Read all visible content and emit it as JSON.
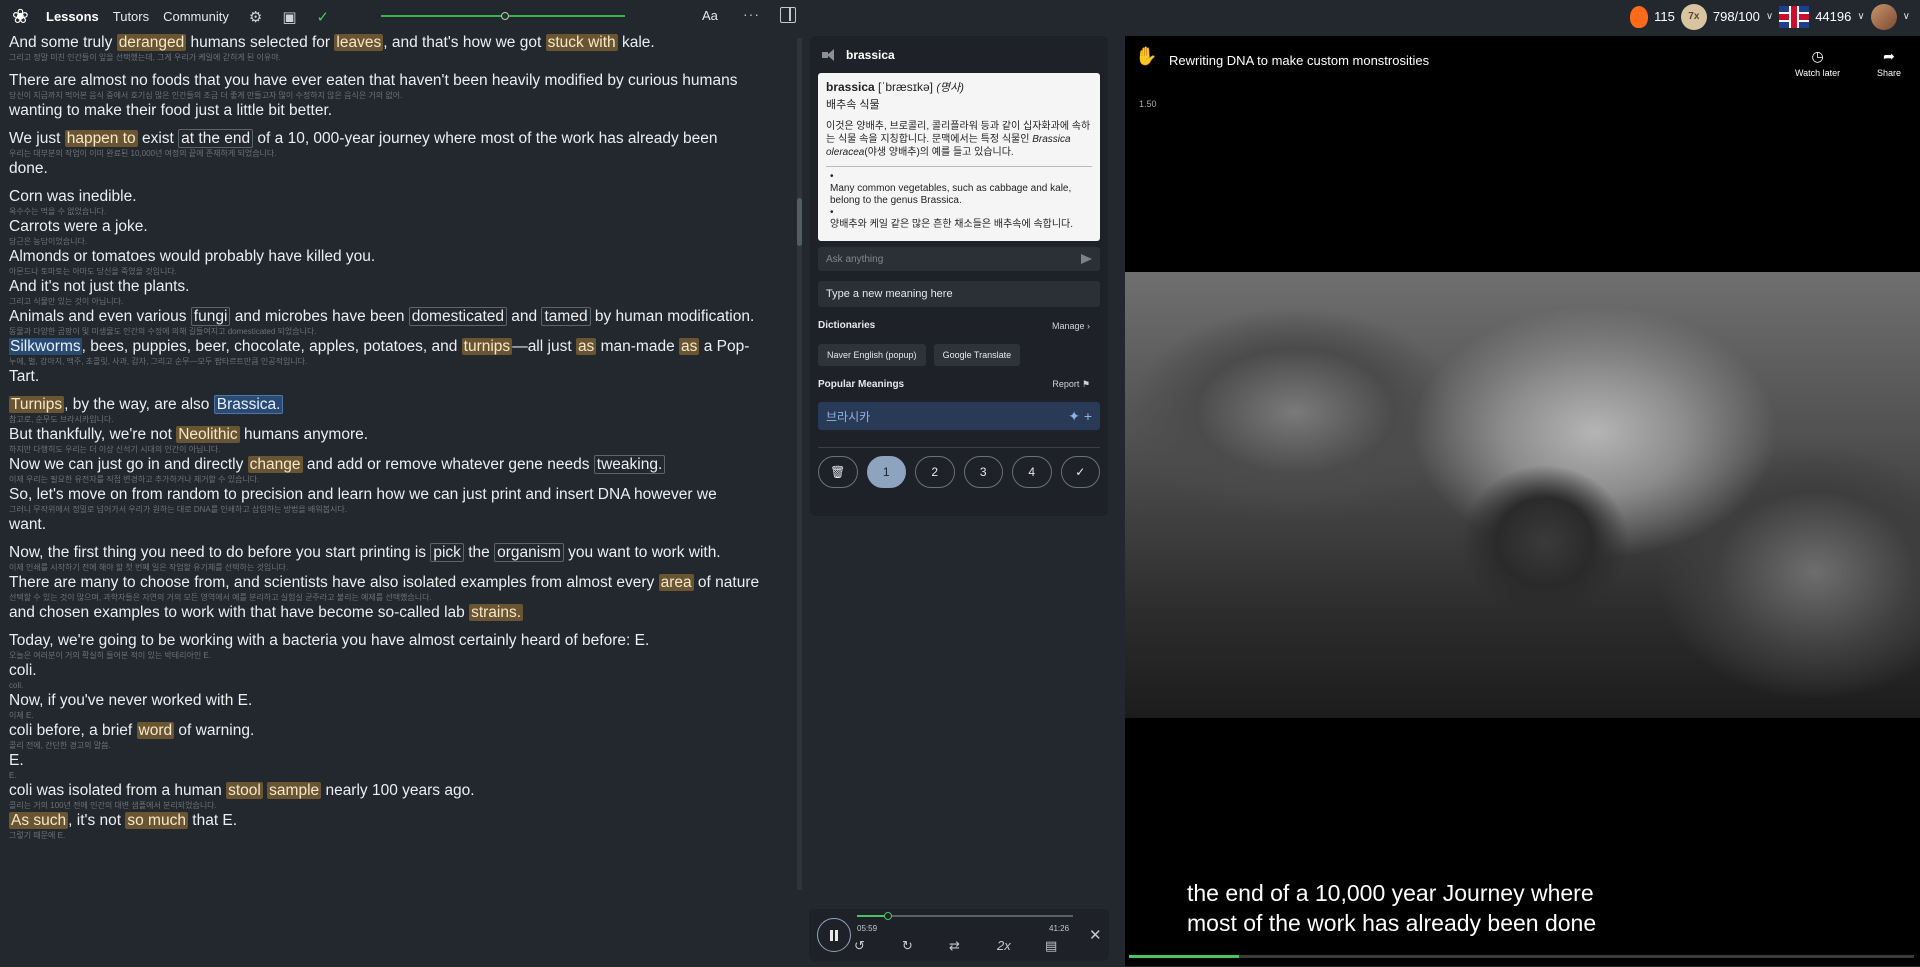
{
  "topbar": {
    "nav": [
      "Lessons",
      "Tutors",
      "Community"
    ],
    "font_label": "Aa",
    "streak": "115",
    "coin_label": "7x",
    "daily_progress": "798/100",
    "score": "44196",
    "lesson_progress": 0.51
  },
  "reader": {
    "paragraphs": [
      {
        "lines": [
          {
            "segments": [
              [
                "And some truly ",
                ""
              ],
              [
                "deranged",
                "hl"
              ],
              [
                " humans selected for ",
                ""
              ],
              [
                "leaves",
                "hl"
              ],
              [
                ", and that's how we got ",
                ""
              ],
              [
                "stuck with",
                "hl"
              ],
              [
                " kale.",
                ""
              ]
            ],
            "tr": "그리고 정말 미친 인간들이 잎을 선택했는데, 그게 우리가 케일에 갇히게 된 이유야."
          }
        ]
      },
      {
        "lines": [
          {
            "segments": [
              [
                "There are almost no foods that you have ever eaten that haven't been heavily modified by curious humans",
                ""
              ]
            ],
            "tr": "당신이 지금까지 먹어본 음식 중에서 호기심 많은 인간들의 조금 더 좋게 만들고자 많이 수정하지 않은 음식은 거의 없어."
          },
          {
            "segments": [
              [
                "wanting to make their food just a little bit better.",
                ""
              ]
            ],
            "tr": ""
          }
        ]
      },
      {
        "lines": [
          {
            "segments": [
              [
                "We just ",
                ""
              ],
              [
                "happen to",
                "hl"
              ],
              [
                " exist ",
                ""
              ],
              [
                "at the end",
                "box"
              ],
              [
                " of a 10, 000-year journey where most of the work has already been",
                ""
              ]
            ],
            "tr": "우리는 대부분의 작업이 이미 완료된 10,000년 여정의 끝에 존재하게 되었습니다."
          },
          {
            "segments": [
              [
                "done.",
                ""
              ]
            ],
            "tr": ""
          }
        ]
      },
      {
        "lines": [
          {
            "segments": [
              [
                "Corn was inedible.",
                ""
              ]
            ],
            "tr": "옥수수는 먹을 수 없었습니다."
          },
          {
            "segments": [
              [
                "Carrots were a joke.",
                ""
              ]
            ],
            "tr": "당근은 농담이었습니다."
          },
          {
            "segments": [
              [
                "Almonds or tomatoes would probably have killed you.",
                ""
              ]
            ],
            "tr": "아몬드나 토마토는 아마도 당신을 죽였을 것입니다."
          },
          {
            "segments": [
              [
                "And it's not just the plants.",
                ""
              ]
            ],
            "tr": "그리고 식물만 있는 것이 아닙니다."
          },
          {
            "segments": [
              [
                "Animals and even various ",
                ""
              ],
              [
                "fungi",
                "box"
              ],
              [
                " and microbes have been ",
                ""
              ],
              [
                "domesticated",
                "box"
              ],
              [
                " and ",
                ""
              ],
              [
                "tamed",
                "box"
              ],
              [
                " by human modification.",
                ""
              ]
            ],
            "tr": "동물과 다양한 곰팡이 및 미생물도 인간의 수정에 의해 길들여지고 domesticated 되었습니다."
          },
          {
            "segments": [
              [
                "Silkworms",
                "lu"
              ],
              [
                ", bees, puppies, beer, chocolate, apples, potatoes, and ",
                ""
              ],
              [
                "turnips",
                "hl"
              ],
              [
                "—all just ",
                ""
              ],
              [
                "as",
                "hl"
              ],
              [
                " man-made ",
                ""
              ],
              [
                "as",
                "hl"
              ],
              [
                " a Pop-",
                ""
              ]
            ],
            "tr": "누에, 벌, 강아지, 맥주, 초콜릿, 사과, 감자, 그리고 순무—모두 팝타르트만큼 인공적입니다."
          },
          {
            "segments": [
              [
                "Tart.",
                ""
              ]
            ],
            "tr": ""
          }
        ]
      },
      {
        "lines": [
          {
            "segments": [
              [
                "Turnips",
                "hl"
              ],
              [
                ", by the way, are also ",
                ""
              ],
              [
                "Brassica.",
                "sel"
              ]
            ],
            "tr": "참고로, 순무도 브라시카입니다."
          },
          {
            "segments": [
              [
                "But thankfully, we're not ",
                ""
              ],
              [
                "Neolithic",
                "hl"
              ],
              [
                " humans anymore.",
                ""
              ]
            ],
            "tr": "하지만 다행히도 우리는 더 이상 신석기 시대의 인간이 아닙니다."
          },
          {
            "segments": [
              [
                "Now we can just go in and directly ",
                ""
              ],
              [
                "change",
                "hl"
              ],
              [
                " and add or remove whatever gene needs ",
                ""
              ],
              [
                "tweaking.",
                "box"
              ]
            ],
            "tr": "이제 우리는 필요한 유전자를 직접 변경하고 추가하거나 제거할 수 있습니다."
          },
          {
            "segments": [
              [
                "So, let's move on from random to precision and learn how we can just print and insert DNA however we",
                ""
              ]
            ],
            "tr": "그러니 무작위에서 정밀로 넘어가서 우리가 원하는 대로 DNA를 인쇄하고 삽입하는 방법을 배워봅시다."
          },
          {
            "segments": [
              [
                "want.",
                ""
              ]
            ],
            "tr": ""
          }
        ]
      },
      {
        "lines": [
          {
            "segments": [
              [
                "Now, the first thing you need to do before you start printing is ",
                ""
              ],
              [
                "pick",
                "box"
              ],
              [
                " the ",
                ""
              ],
              [
                "organism",
                "box"
              ],
              [
                " you want to work with.",
                ""
              ]
            ],
            "tr": "이제 인쇄를 시작하기 전에 해야 할 첫 번째 일은 작업할 유기체를 선택하는 것입니다."
          },
          {
            "segments": [
              [
                "There are many to choose from, and scientists have also isolated examples from almost every ",
                ""
              ],
              [
                "area",
                "hl"
              ],
              [
                " of nature",
                ""
              ]
            ],
            "tr": "선택할 수 있는 것이 많으며, 과학자들은 자연의 거의 모든 영역에서 예를 분리하고 실험실 균주라고 불리는 예제를 선택했습니다."
          },
          {
            "segments": [
              [
                "and chosen examples to work with that have become so-called lab ",
                ""
              ],
              [
                "strains.",
                "hl"
              ]
            ],
            "tr": ""
          }
        ]
      },
      {
        "lines": [
          {
            "segments": [
              [
                "Today, we're going to be working with a bacteria you have almost certainly heard of before: E.",
                ""
              ]
            ],
            "tr": "오늘은 여러분이 거의 확실히 들어본 적이 있는 박테리아인 E."
          },
          {
            "segments": [
              [
                "coli.",
                ""
              ]
            ],
            "tr": "coli."
          },
          {
            "segments": [
              [
                "Now, if you've never worked with E.",
                ""
              ]
            ],
            "tr": "이제 E."
          },
          {
            "segments": [
              [
                "coli before, a brief ",
                ""
              ],
              [
                "word",
                "hl"
              ],
              [
                " of warning.",
                ""
              ]
            ],
            "tr": "콜리 전에, 간단한 경고의 말씀."
          },
          {
            "segments": [
              [
                "E.",
                ""
              ]
            ],
            "tr": "E."
          },
          {
            "segments": [
              [
                "coli was isolated from a human ",
                ""
              ],
              [
                "stool",
                "hl"
              ],
              [
                " ",
                ""
              ],
              [
                "sample",
                "hl"
              ],
              [
                " nearly 100 years ago.",
                ""
              ]
            ],
            "tr": "콜리는 거의 100년 전에 인간의 대변 샘플에서 분리되었습니다."
          },
          {
            "segments": [
              [
                "As such",
                "hl"
              ],
              [
                ", it's not ",
                ""
              ],
              [
                "so much",
                "hl"
              ],
              [
                " that E.",
                ""
              ]
            ],
            "tr": "그렇기 때문에 E."
          }
        ]
      }
    ]
  },
  "dictionary": {
    "word": "brassica",
    "headword": "brassica",
    "ipa": " [ˈbræsɪkə] ",
    "pos": "(명사)",
    "sub": "배추속 식물",
    "definition_pre": "이것은 양배추, 브로콜리, 콜리플라워 등과 같이 십자화과에 속하는 식물 속을 지칭합니다. 문맥에서는 특정 식물인 ",
    "definition_em": "Brassica oleracea",
    "definition_post": "(야생 양배추)의 예를 들고 있습니다.",
    "examples": [
      "Many common vegetables, such as cabbage and kale, belong to the genus Brassica.",
      "양배추와 케일 같은 많은 흔한 채소들은 배추속에 속합니다."
    ],
    "ask_placeholder": "Ask anything",
    "meaning_placeholder": "Type a new meaning here",
    "dictionaries_label": "Dictionaries",
    "manage_label": "Manage",
    "chips": [
      "Naver English (popup)",
      "Google Translate"
    ],
    "popular_label": "Popular Meanings",
    "report_label": "Report",
    "popular_meaning": "브라시카",
    "ratings": [
      "1",
      "2",
      "3",
      "4"
    ],
    "selected_rating": "1"
  },
  "player": {
    "current_time": "05:59",
    "duration": "41:26",
    "progress": 0.144,
    "speed_label": "2x"
  },
  "video": {
    "title": "Rewriting DNA to make custom monstrosities",
    "watch_later": "Watch later",
    "share": "Share",
    "speed": "1.50",
    "subtitle_1": "the end of a 10,000 year Journey where",
    "subtitle_2": "most of the work has already been done"
  },
  "colors": {
    "highlight": "#6a5532",
    "selected": "#294b73",
    "accent_green": "#4cc45e"
  }
}
